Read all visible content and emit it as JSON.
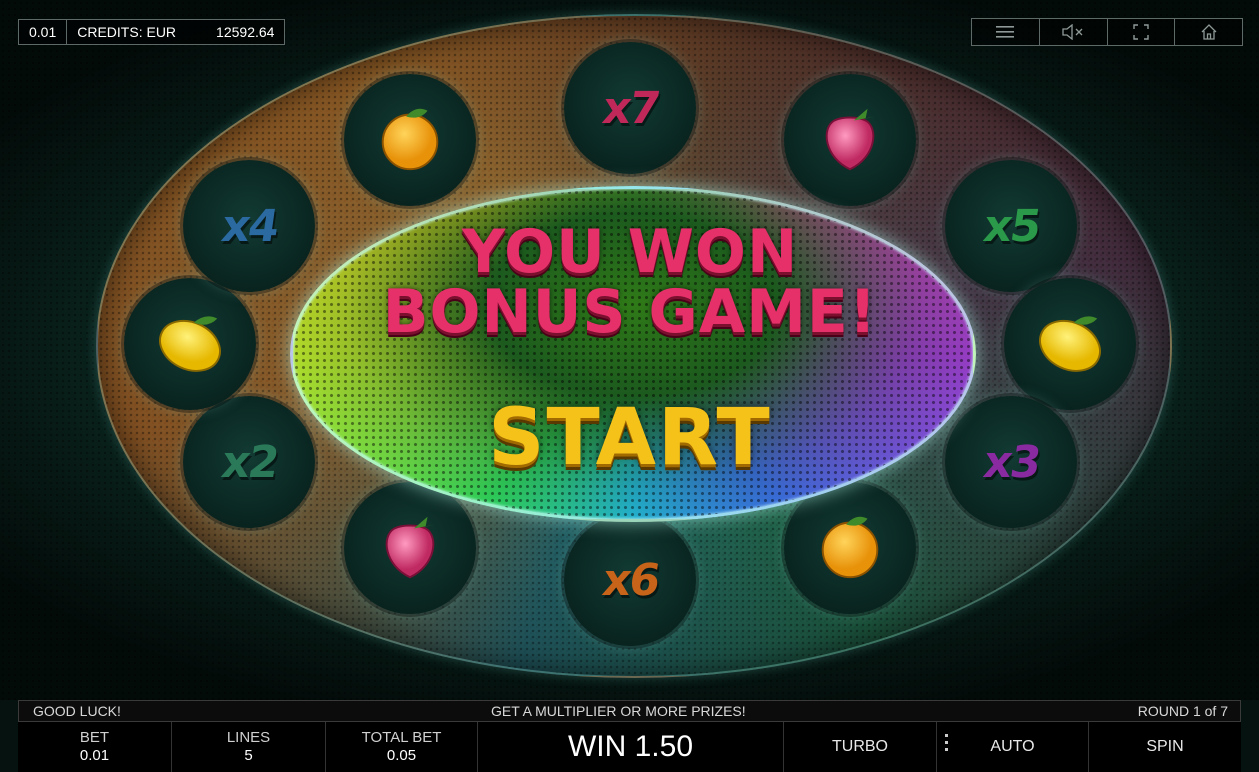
{
  "header": {
    "denomination": "0.01",
    "credits_label": "CREDITS: EUR",
    "credits_value": "12592.64",
    "icons": [
      "menu-icon",
      "sound-muted-icon",
      "fullscreen-icon",
      "home-icon"
    ]
  },
  "wheel": {
    "slots": [
      {
        "kind": "multiplier",
        "label": "x7",
        "color": "#c0285a"
      },
      {
        "kind": "fruit",
        "fruit": "raspberry"
      },
      {
        "kind": "multiplier",
        "label": "x5",
        "color": "#2a9a4a"
      },
      {
        "kind": "fruit",
        "fruit": "lemon"
      },
      {
        "kind": "multiplier",
        "label": "x3",
        "color": "#8a2aa0"
      },
      {
        "kind": "fruit",
        "fruit": "orange"
      },
      {
        "kind": "multiplier",
        "label": "x6",
        "color": "#c8641a"
      },
      {
        "kind": "fruit",
        "fruit": "raspberry"
      },
      {
        "kind": "multiplier",
        "label": "x2",
        "color": "#2a7a5a"
      },
      {
        "kind": "fruit",
        "fruit": "lemon"
      },
      {
        "kind": "multiplier",
        "label": "x4",
        "color": "#2a6aa0"
      },
      {
        "kind": "fruit",
        "fruit": "orange"
      }
    ]
  },
  "center": {
    "headline_line1": "YOU WON",
    "headline_line2": "BONUS GAME!",
    "start_label": "START"
  },
  "info_bar": {
    "left": "GOOD LUCK!",
    "center": "GET A MULTIPLIER OR MORE PRIZES!",
    "right": "ROUND 1 of 7"
  },
  "controls": {
    "bet_label": "BET",
    "bet_value": "0.01",
    "lines_label": "LINES",
    "lines_value": "5",
    "total_bet_label": "TOTAL BET",
    "total_bet_value": "0.05",
    "win_text": "WIN 1.50",
    "turbo_label": "TURBO",
    "auto_label": "AUTO",
    "spin_label": "SPIN"
  }
}
